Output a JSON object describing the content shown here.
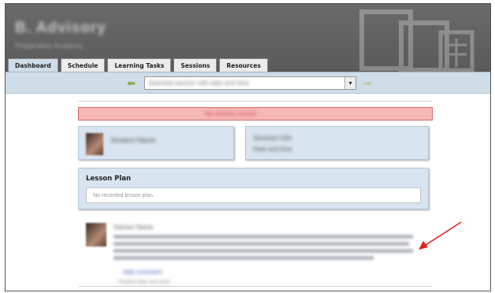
{
  "header": {
    "brand": "B. Advisory",
    "subtitle": "Preparatory Academy"
  },
  "tabs": [
    {
      "label": "Dashboard",
      "active": true
    },
    {
      "label": "Schedule",
      "active": false
    },
    {
      "label": "Learning Tasks",
      "active": false
    },
    {
      "label": "Sessions",
      "active": false
    },
    {
      "label": "Resources",
      "active": false
    }
  ],
  "session_selector": {
    "value": "Selected session with date and time",
    "dropdown_glyph": "▾"
  },
  "alert": {
    "text": "No session record"
  },
  "cards": {
    "student": {
      "name": "Student Name"
    },
    "session": {
      "line1": "Session Info",
      "line2": "Date and time"
    }
  },
  "lesson_plan": {
    "title": "Lesson Plan",
    "empty_text": "No recorded lesson plan."
  },
  "note": {
    "author": "Advisor Name",
    "link1": "Add comment",
    "meta": "Posted date and time"
  },
  "colors": {
    "header_bg": "#5f5f5f",
    "nav_bg": "#cfdde9",
    "alert_bg": "#f6b7b7",
    "card_bg": "#d8e4ef",
    "annotation_arrow": "#e02020"
  },
  "icons": {
    "prev": "arrow-left-icon",
    "next": "arrow-right-icon",
    "dropdown": "chevron-down-icon"
  }
}
